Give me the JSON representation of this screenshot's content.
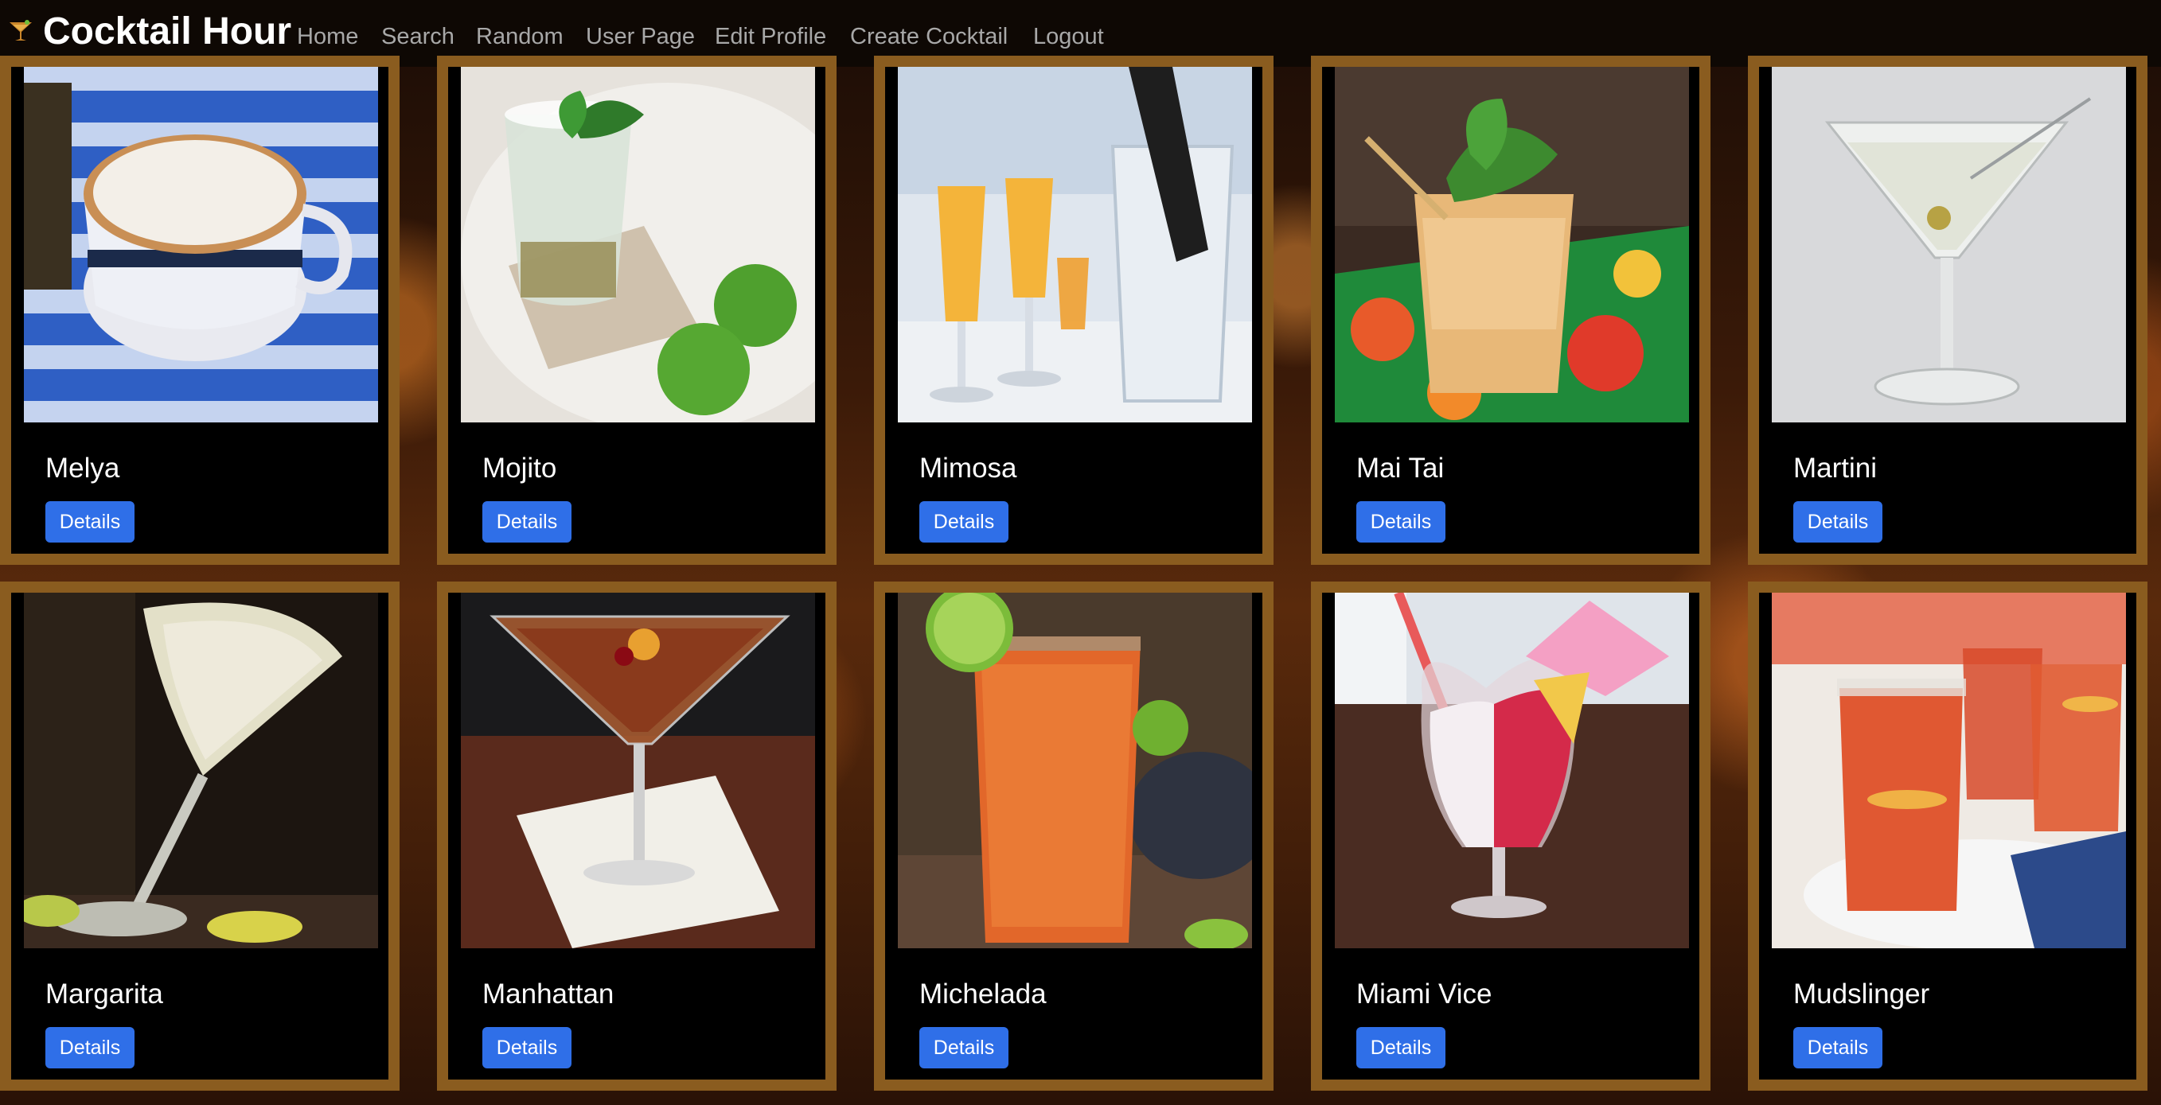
{
  "app": {
    "title": "Cocktail Hour"
  },
  "nav": {
    "links": [
      "Home",
      "Search",
      "Random",
      "User Page",
      "Edit Profile",
      "Create Cocktail",
      "Logout"
    ]
  },
  "cocktails": [
    {
      "name": "Melya",
      "button": "Details"
    },
    {
      "name": "Mojito",
      "button": "Details"
    },
    {
      "name": "Mimosa",
      "button": "Details"
    },
    {
      "name": "Mai Tai",
      "button": "Details"
    },
    {
      "name": "Martini",
      "button": "Details"
    },
    {
      "name": "Margarita",
      "button": "Details"
    },
    {
      "name": "Manhattan",
      "button": "Details"
    },
    {
      "name": "Michelada",
      "button": "Details"
    },
    {
      "name": "Miami Vice",
      "button": "Details"
    },
    {
      "name": "Mudslinger",
      "button": "Details"
    }
  ],
  "colors": {
    "card_border": "#8a5c1f",
    "button": "#2f6fe8",
    "nav_link": "#a8a8a8"
  }
}
